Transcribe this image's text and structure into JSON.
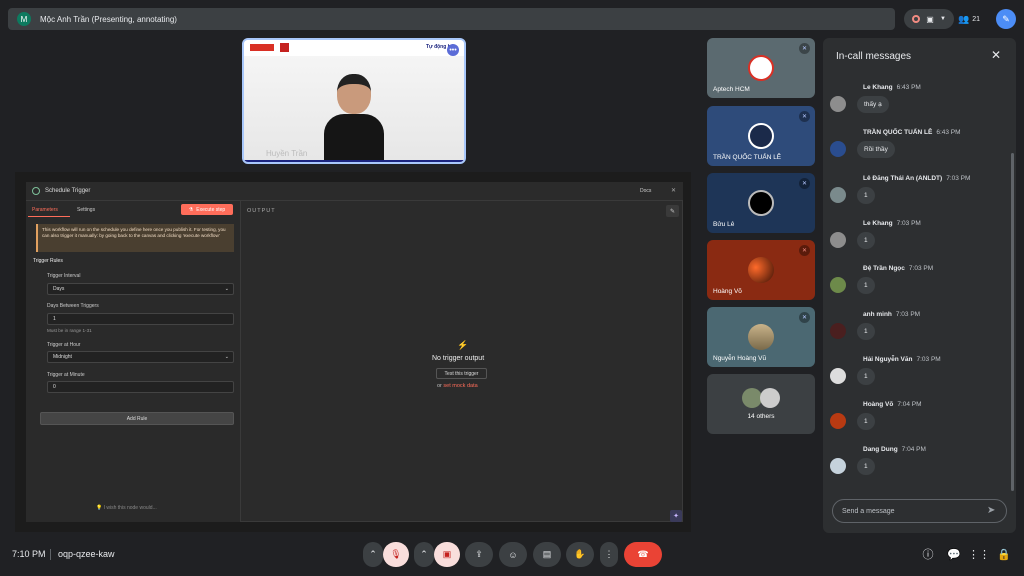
{
  "top": {
    "avatar_letter": "M",
    "title": "Mộc Anh Trần (Presenting, annotating)",
    "participant_count": "21"
  },
  "presenter": {
    "brand_text": "Tự động hóa",
    "name_overlay": "Huyền Trần"
  },
  "n8n": {
    "title": "Schedule Trigger",
    "docs": "Docs",
    "tab_params": "Parameters",
    "tab_settings": "Settings",
    "execute_btn": "Execute step",
    "notice": "This workflow will run on the schedule you define here once you publish it. For testing, you can also trigger it manually: by going back to the canvas and clicking 'execute workflow'",
    "trigger_rules": "Trigger Rules",
    "interval_label": "Trigger Interval",
    "interval_value": "Days",
    "days_between_label": "Days Between Triggers",
    "days_between_value": "1",
    "days_hint": "Must be in range 1-31",
    "hour_label": "Trigger at Hour",
    "hour_value": "Midnight",
    "minute_label": "Trigger at Minute",
    "minute_value": "0",
    "add_rule": "Add Rule",
    "wish": "I wish this node would...",
    "output_label": "OUTPUT",
    "no_output": "No trigger output",
    "test_btn": "Test this trigger",
    "or_text": "or",
    "mock_link": "set mock data"
  },
  "participants": [
    {
      "name": "Aptech HCM",
      "bg": "#5b6a70"
    },
    {
      "name": "TRẦN QUỐC TUẤN LÊ",
      "bg": "#2e4b7a"
    },
    {
      "name": "Bửu Lê",
      "bg": "#1e3557"
    },
    {
      "name": "Hoàng Võ",
      "bg": "#8a2a12"
    },
    {
      "name": "Nguyễn Hoàng Vũ",
      "bg": "#4b6872"
    },
    {
      "name": "14 others",
      "bg": "#3c4043"
    }
  ],
  "chat": {
    "title": "In-call messages",
    "placeholder": "Send a message",
    "messages": [
      {
        "name": "Le Khang",
        "time": "6:43 PM",
        "text": "thấy ạ",
        "color": "#8d8d8d"
      },
      {
        "name": "TRẦN QUỐC TUẤN LÊ",
        "time": "6:43 PM",
        "text": "Rồi thầy",
        "color": "#2a4d8f"
      },
      {
        "name": "Lê Đăng Thái An (ANLDT)",
        "time": "7:03 PM",
        "text": "1",
        "color": "#7a8a8c"
      },
      {
        "name": "Le Khang",
        "time": "7:03 PM",
        "text": "1",
        "color": "#8d8d8d"
      },
      {
        "name": "Đệ Trần Ngọc",
        "time": "7:03 PM",
        "text": "1",
        "color": "#6d8a4a"
      },
      {
        "name": "anh minh",
        "time": "7:03 PM",
        "text": "1",
        "color": "#4a1f1f"
      },
      {
        "name": "Hải Nguyễn Văn",
        "time": "7:03 PM",
        "text": "1",
        "color": "#dddddd"
      },
      {
        "name": "Hoàng Võ",
        "time": "7:04 PM",
        "text": "1",
        "color": "#b83a12"
      },
      {
        "name": "Dang Dung",
        "time": "7:04 PM",
        "text": "1",
        "color": "#c5d2dc"
      }
    ]
  },
  "bottom": {
    "time": "7:10 PM",
    "code": "oqp-qzee-kaw"
  }
}
